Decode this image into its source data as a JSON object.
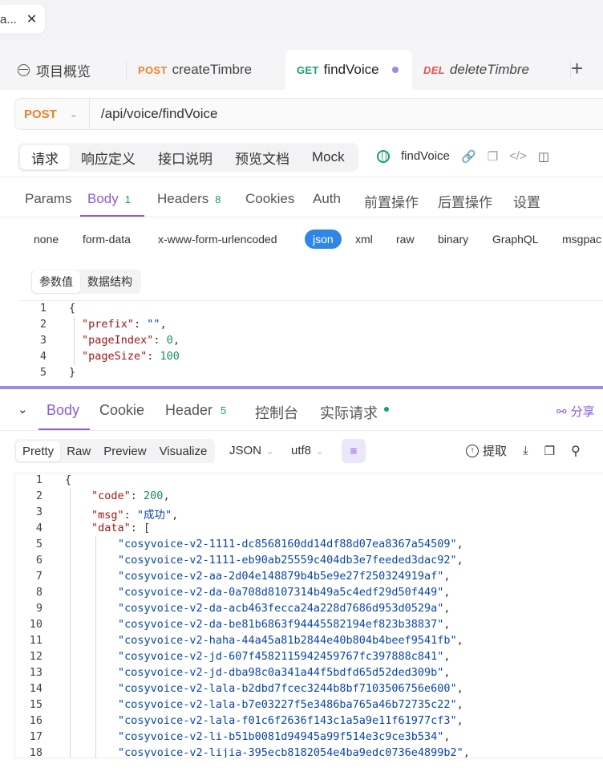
{
  "window_tab": {
    "label": "a...",
    "close": "✕"
  },
  "api_tabs": [
    {
      "method": "",
      "label": "项目概览",
      "icon": "overview-icon"
    },
    {
      "method": "POST",
      "label": "createTimbre"
    },
    {
      "method": "GET",
      "label": "findVoice",
      "unsaved": true
    },
    {
      "method": "DEL",
      "label": "deleteTimbre"
    }
  ],
  "add_tab_label": "+",
  "request": {
    "method": "POST",
    "path": "/api/voice/findVoice",
    "sub_tabs": [
      "请求",
      "响应定义",
      "接口说明",
      "预览文档",
      "Mock"
    ],
    "endpoint_name": "findVoice",
    "param_tabs": [
      {
        "label": "Params",
        "count": ""
      },
      {
        "label": "Body",
        "count": "1"
      },
      {
        "label": "Headers",
        "count": "8"
      },
      {
        "label": "Cookies",
        "count": ""
      },
      {
        "label": "Auth",
        "count": ""
      },
      {
        "label": "前置操作",
        "count": ""
      },
      {
        "label": "后置操作",
        "count": ""
      },
      {
        "label": "设置",
        "count": ""
      }
    ],
    "body_types": [
      "none",
      "form-data",
      "x-www-form-urlencoded",
      "json",
      "xml",
      "raw",
      "binary",
      "GraphQL",
      "msgpac"
    ],
    "view_tabs": [
      "参数值",
      "数据结构"
    ],
    "body_lines": [
      {
        "n": "1",
        "indent": 0,
        "tokens": [
          [
            "p",
            "{"
          ]
        ]
      },
      {
        "n": "2",
        "indent": 1,
        "tokens": [
          [
            "k",
            "\"prefix\""
          ],
          [
            "p",
            ": "
          ],
          [
            "s",
            "\"\""
          ],
          [
            "p",
            ","
          ]
        ]
      },
      {
        "n": "3",
        "indent": 1,
        "tokens": [
          [
            "k",
            "\"pageIndex\""
          ],
          [
            "p",
            ": "
          ],
          [
            "n",
            "0"
          ],
          [
            "p",
            ","
          ]
        ]
      },
      {
        "n": "4",
        "indent": 1,
        "tokens": [
          [
            "k",
            "\"pageSize\""
          ],
          [
            "p",
            ": "
          ],
          [
            "n",
            "100"
          ]
        ]
      },
      {
        "n": "5",
        "indent": 0,
        "tokens": [
          [
            "p",
            "}"
          ]
        ]
      }
    ]
  },
  "response": {
    "tabs": [
      {
        "label": "Body",
        "count": ""
      },
      {
        "label": "Cookie",
        "count": ""
      },
      {
        "label": "Header",
        "count": "5"
      },
      {
        "label": "控制台",
        "count": ""
      },
      {
        "label": "实际请求",
        "count": ""
      }
    ],
    "share_label": "分享",
    "formats": [
      "Pretty",
      "Raw",
      "Preview",
      "Visualize"
    ],
    "content_type": "JSON",
    "encoding": "utf8",
    "extract_label": "提取",
    "lines": [
      {
        "n": "1",
        "indent": 0,
        "tokens": [
          [
            "p",
            "{"
          ]
        ]
      },
      {
        "n": "2",
        "indent": 1,
        "tokens": [
          [
            "k",
            "\"code\""
          ],
          [
            "p",
            ": "
          ],
          [
            "n",
            "200"
          ],
          [
            "p",
            ","
          ]
        ]
      },
      {
        "n": "3",
        "indent": 1,
        "tokens": [
          [
            "k",
            "\"msg\""
          ],
          [
            "p",
            ": "
          ],
          [
            "s",
            "\"成功\""
          ],
          [
            "p",
            ","
          ]
        ]
      },
      {
        "n": "4",
        "indent": 1,
        "tokens": [
          [
            "k",
            "\"data\""
          ],
          [
            "p",
            ": ["
          ]
        ]
      },
      {
        "n": "5",
        "indent": 2,
        "tokens": [
          [
            "s",
            "\"cosyvoice-v2-1111-dc8568160dd14df88d07ea8367a54509\""
          ],
          [
            "p",
            ","
          ]
        ]
      },
      {
        "n": "6",
        "indent": 2,
        "tokens": [
          [
            "s",
            "\"cosyvoice-v2-1111-eb90ab25559c404db3e7feeded3dac92\""
          ],
          [
            "p",
            ","
          ]
        ]
      },
      {
        "n": "7",
        "indent": 2,
        "tokens": [
          [
            "s",
            "\"cosyvoice-v2-aa-2d04e148879b4b5e9e27f250324919af\""
          ],
          [
            "p",
            ","
          ]
        ]
      },
      {
        "n": "8",
        "indent": 2,
        "tokens": [
          [
            "s",
            "\"cosyvoice-v2-da-0a708d8107314b49a5c4edf29d50f449\""
          ],
          [
            "p",
            ","
          ]
        ]
      },
      {
        "n": "9",
        "indent": 2,
        "tokens": [
          [
            "s",
            "\"cosyvoice-v2-da-acb463fecca24a228d7686d953d0529a\""
          ],
          [
            "p",
            ","
          ]
        ]
      },
      {
        "n": "10",
        "indent": 2,
        "tokens": [
          [
            "s",
            "\"cosyvoice-v2-da-be81b6863f94445582194ef823b38837\""
          ],
          [
            "p",
            ","
          ]
        ]
      },
      {
        "n": "11",
        "indent": 2,
        "tokens": [
          [
            "s",
            "\"cosyvoice-v2-haha-44a45a81b2844e40b804b4beef9541fb\""
          ],
          [
            "p",
            ","
          ]
        ]
      },
      {
        "n": "12",
        "indent": 2,
        "tokens": [
          [
            "s",
            "\"cosyvoice-v2-jd-607f4582115942459767fc397888c841\""
          ],
          [
            "p",
            ","
          ]
        ]
      },
      {
        "n": "13",
        "indent": 2,
        "tokens": [
          [
            "s",
            "\"cosyvoice-v2-jd-dba98c0a341a44f5bdfd65d52ded309b\""
          ],
          [
            "p",
            ","
          ]
        ]
      },
      {
        "n": "14",
        "indent": 2,
        "tokens": [
          [
            "s",
            "\"cosyvoice-v2-lala-b2dbd7fcec3244b8bf7103506756e600\""
          ],
          [
            "p",
            ","
          ]
        ]
      },
      {
        "n": "15",
        "indent": 2,
        "tokens": [
          [
            "s",
            "\"cosyvoice-v2-lala-b7e03227f5e3486ba765a46b72735c22\""
          ],
          [
            "p",
            ","
          ]
        ]
      },
      {
        "n": "16",
        "indent": 2,
        "tokens": [
          [
            "s",
            "\"cosyvoice-v2-lala-f01c6f2636f143c1a5a9e11f61977cf3\""
          ],
          [
            "p",
            ","
          ]
        ]
      },
      {
        "n": "17",
        "indent": 2,
        "tokens": [
          [
            "s",
            "\"cosyvoice-v2-li-b51b0081d94945a99f514e3c9ce3b534\""
          ],
          [
            "p",
            ","
          ]
        ]
      },
      {
        "n": "18",
        "indent": 2,
        "tokens": [
          [
            "s",
            "\"cosyvoice-v2-lijia-395ecb8182054e4ba9edc0736e4899b2\""
          ],
          [
            "p",
            ","
          ]
        ]
      }
    ]
  },
  "colors": {
    "accent": "#8c5bd6",
    "post": "#e8832a",
    "get": "#1aa06d",
    "del": "#e05252",
    "json_active": "#2f86e5"
  }
}
